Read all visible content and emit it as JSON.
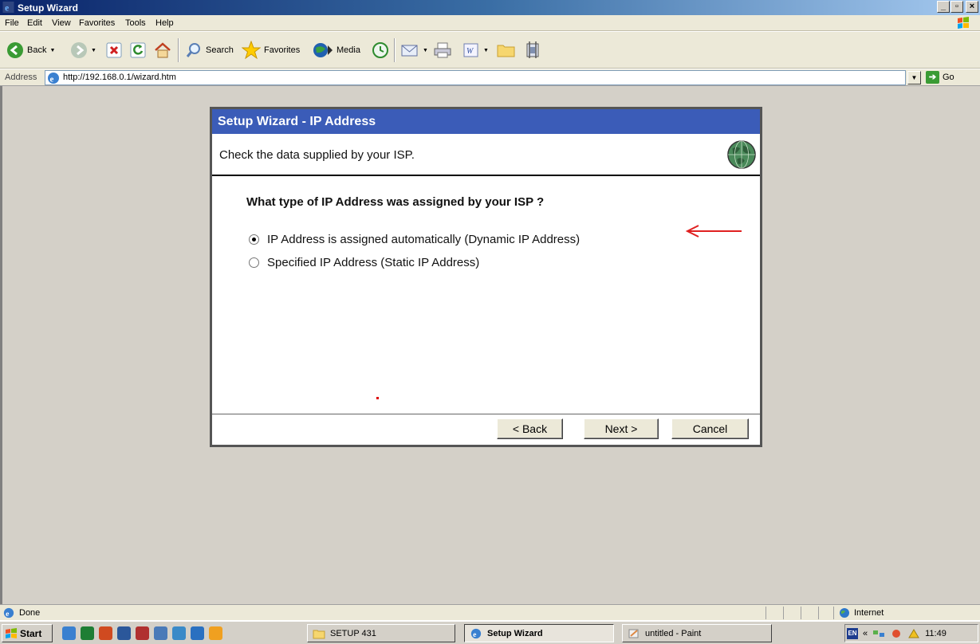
{
  "window": {
    "title": "Setup Wizard",
    "controls": [
      "_",
      "▫",
      "×"
    ]
  },
  "menu": [
    "File",
    "Edit",
    "View",
    "Favorites",
    "Tools",
    "Help"
  ],
  "toolbar": {
    "back": "Back",
    "search": "Search",
    "favorites": "Favorites",
    "media": "Media"
  },
  "address": {
    "label": "Address",
    "url": "http://192.168.0.1/wizard.htm",
    "go": "Go"
  },
  "wizard": {
    "title": "Setup Wizard - IP Address",
    "subtitle": "Check the data supplied by your ISP.",
    "question": "What type of IP Address was assigned by your ISP ?",
    "options": [
      {
        "label": "IP Address is assigned automatically (Dynamic IP Address)",
        "selected": true
      },
      {
        "label": "Specified IP Address (Static IP Address)",
        "selected": false
      }
    ],
    "buttons": {
      "back": "< Back",
      "next": "Next >",
      "cancel": "Cancel"
    }
  },
  "status": {
    "text": "Done",
    "zone": "Internet"
  },
  "taskbar": {
    "start": "Start",
    "tasks": [
      "SETUP 431",
      "Setup Wizard",
      "untitled - Paint"
    ],
    "clock": "11:49",
    "lang": "EN",
    "tray_chevron": "«"
  },
  "colors": {
    "title_gradient_start": "#0a246a",
    "wizard_header": "#3b5cb8",
    "content_bg": "#d4d0c8",
    "annotation_arrow": "#e02020"
  }
}
